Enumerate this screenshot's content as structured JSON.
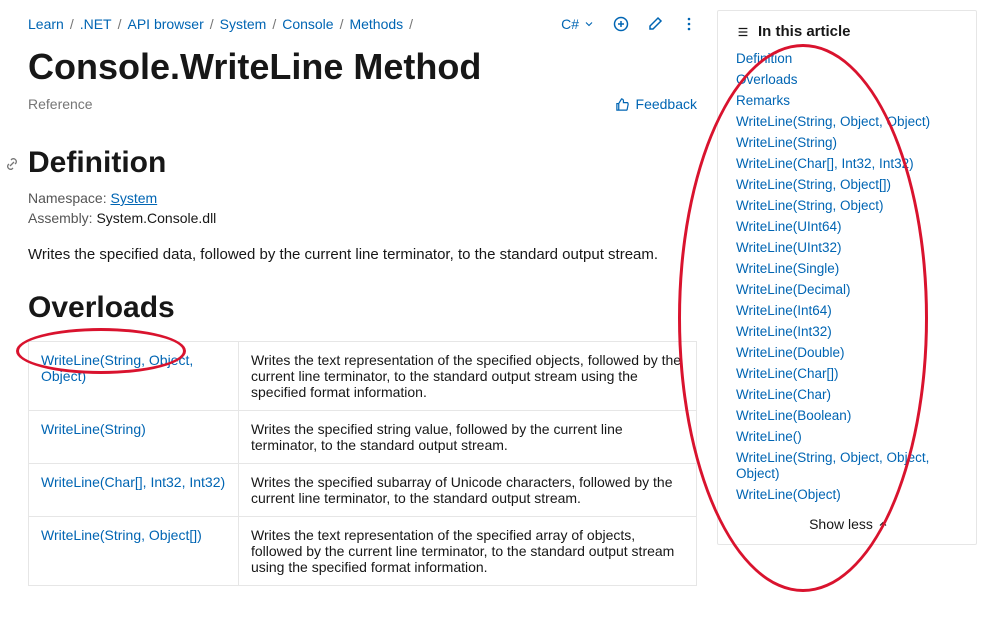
{
  "breadcrumb": {
    "items": [
      "Learn",
      ".NET",
      "API browser",
      "System",
      "Console",
      "Methods"
    ],
    "sep": "/"
  },
  "toolbar": {
    "lang": "C#",
    "feedback": "Feedback"
  },
  "page": {
    "title": "Console.WriteLine Method",
    "ref": "Reference"
  },
  "definition": {
    "heading": "Definition",
    "ns_label": "Namespace:",
    "ns_val": "System",
    "asm_label": "Assembly:",
    "asm_val": "System.Console.dll",
    "desc": "Writes the specified data, followed by the current line terminator, to the standard output stream."
  },
  "overloads": {
    "heading": "Overloads",
    "rows": [
      {
        "sig": "WriteLine(String, Object, Object)",
        "desc": "Writes the text representation of the specified objects, followed by the current line terminator, to the standard output stream using the specified format information."
      },
      {
        "sig": "WriteLine(String)",
        "desc": "Writes the specified string value, followed by the current line terminator, to the standard output stream."
      },
      {
        "sig": "WriteLine(Char[], Int32, Int32)",
        "desc": "Writes the specified subarray of Unicode characters, followed by the current line terminator, to the standard output stream."
      },
      {
        "sig": "WriteLine(String, Object[])",
        "desc": "Writes the text representation of the specified array of objects, followed by the current line terminator, to the standard output stream using the specified format information."
      }
    ]
  },
  "toc": {
    "title": "In this article",
    "items": [
      "Definition",
      "Overloads",
      "Remarks",
      "WriteLine(String, Object, Object)",
      "WriteLine(String)",
      "WriteLine(Char[], Int32, Int32)",
      "WriteLine(String, Object[])",
      "WriteLine(String, Object)",
      "WriteLine(UInt64)",
      "WriteLine(UInt32)",
      "WriteLine(Single)",
      "WriteLine(Decimal)",
      "WriteLine(Int64)",
      "WriteLine(Int32)",
      "WriteLine(Double)",
      "WriteLine(Char[])",
      "WriteLine(Char)",
      "WriteLine(Boolean)",
      "WriteLine()",
      "WriteLine(String, Object, Object, Object)",
      "WriteLine(Object)"
    ],
    "show_less": "Show less"
  }
}
